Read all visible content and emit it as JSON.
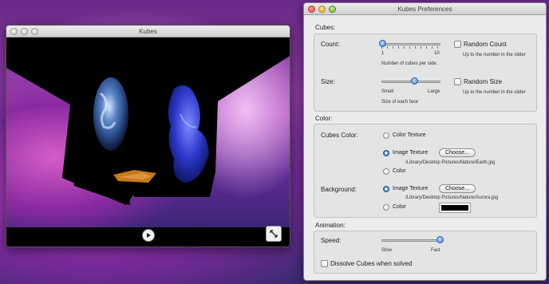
{
  "kubes_window": {
    "title": "Kubes"
  },
  "prefs_window": {
    "title": "Kubes Preferences",
    "cubes": {
      "header": "Cubes:",
      "count_label": "Count:",
      "count_min": "1",
      "count_max": "10",
      "count_value": 1,
      "count_caption": "Number of cubes per side.",
      "random_count_label": "Random Count",
      "random_count_checked": false,
      "random_count_hint": "Up to the number in the slider",
      "size_label": "Size:",
      "size_min_label": "Small",
      "size_max_label": "Large",
      "size_fraction": 0.55,
      "size_caption": "Size of each face",
      "random_size_label": "Random Size",
      "random_size_checked": false,
      "random_size_hint": "Up to the number in the slider"
    },
    "color": {
      "header": "Color:",
      "cubes_color_label": "Cubes Color:",
      "cubes_options": {
        "color_texture": "Color Texture",
        "image_texture": "Image Texture",
        "color": "Color"
      },
      "cubes_selected": "Image Texture",
      "cubes_choose_label": "Choose...",
      "cubes_image_path": "/Library/Desktop Pictures/Nature/Earth.jpg",
      "background_label": "Background:",
      "background_options": {
        "image_texture": "Image Texture",
        "color": "Color"
      },
      "background_selected": "Image Texture",
      "background_choose_label": "Choose...",
      "background_image_path": "/Library/Desktop Pictures/Nature/Aurora.jpg",
      "background_color": "#000000"
    },
    "animation": {
      "header": "Animation:",
      "speed_label": "Speed:",
      "speed_min_label": "Slow",
      "speed_max_label": "Fast",
      "speed_fraction": 1.0,
      "dissolve_label": "Dissolve Cubes when solved",
      "dissolve_checked": false
    }
  },
  "icons": {
    "play": "play-icon",
    "fullscreen": "fullscreen-icon"
  },
  "colors": {
    "accent": "#3a7fd6",
    "close": "#e0443a",
    "minimize": "#e0a820",
    "zoom": "#5ab02a"
  }
}
